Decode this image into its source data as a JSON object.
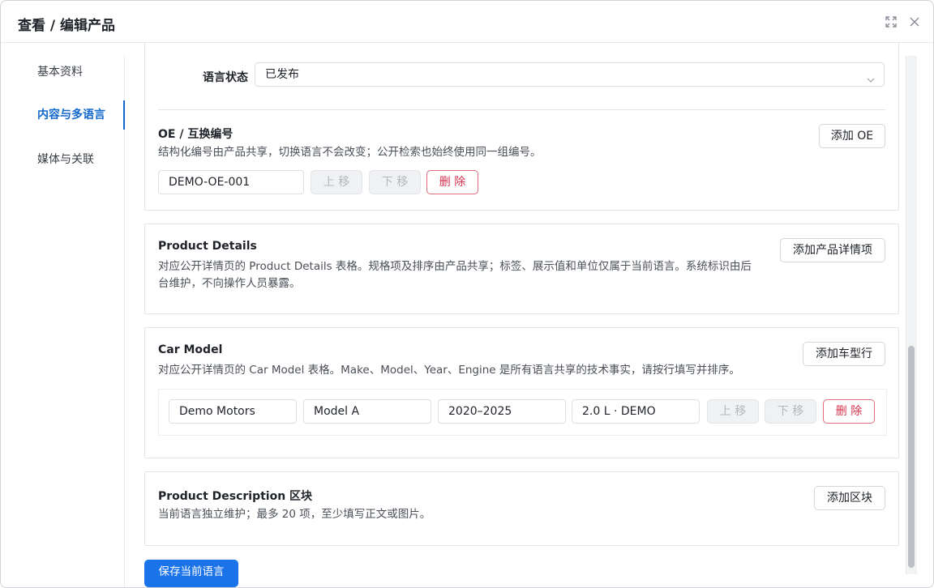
{
  "dialog": {
    "title": "查看 / 编辑产品"
  },
  "sidebar": {
    "items": [
      {
        "label": "基本资料"
      },
      {
        "label": "内容与多语言"
      },
      {
        "label": "媒体与关联"
      }
    ]
  },
  "language_status": {
    "label": "语言状态",
    "value": "已发布"
  },
  "oe_section": {
    "title": "OE / 互换编号",
    "description": "结构化编号由产品共享，切换语言不会改变；公开检索也始终使用同一组编号。",
    "add_label": "添加 OE",
    "rows": [
      {
        "value": "DEMO-OE-001"
      }
    ],
    "move_up_label": "上 移",
    "move_down_label": "下 移",
    "delete_label": "删 除"
  },
  "product_details": {
    "title": "Product Details",
    "description_line1": "对应公开详情页的 Product Details 表格。规格项及排序由产品共享；标签、展示值和单位仅属于当前语言。系统标识由后",
    "description_line2": "台维护，不向操作人员暴露。",
    "add_label": "添加产品详情项"
  },
  "car_model": {
    "title": "Car Model",
    "description": "对应公开详情页的 Car Model 表格。Make、Model、Year、Engine 是所有语言共享的技术事实，请按行填写并排序。",
    "add_label": "添加车型行",
    "rows": [
      {
        "make": "Demo Motors",
        "model": "Model A",
        "year": "2020–2025",
        "engine": "2.0 L · DEMO"
      }
    ],
    "move_up_label": "上 移",
    "move_down_label": "下 移",
    "delete_label": "删 除"
  },
  "product_description": {
    "title": "Product Description 区块",
    "description": "当前语言独立维护；最多 20 项，至少填写正文或图片。",
    "add_label": "添加区块"
  },
  "footer": {
    "save_label": "保存当前语言"
  },
  "icons": {
    "expand": "expand-icon",
    "close": "close-icon",
    "chevron": "chevron-down-icon"
  },
  "colors": {
    "accent": "#1a73e8",
    "danger": "#d4304b",
    "active_nav": "#1468cc"
  }
}
